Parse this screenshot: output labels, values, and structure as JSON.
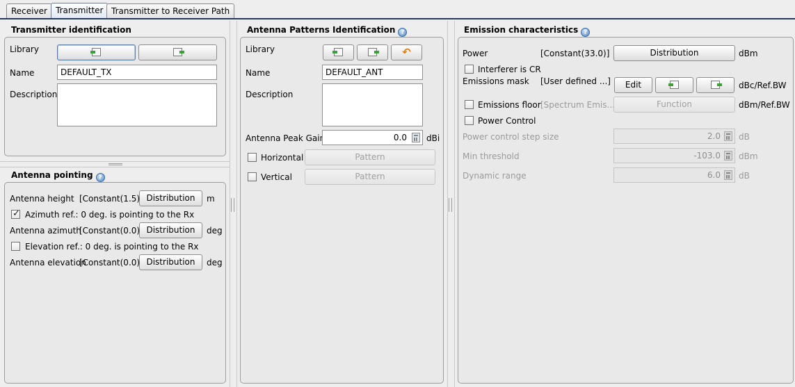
{
  "tabs": [
    {
      "label": "Receiver"
    },
    {
      "label": "Transmitter"
    },
    {
      "label": "Transmitter to Receiver Path"
    }
  ],
  "transmitter_identification": {
    "title": "Transmitter identification",
    "library_label": "Library",
    "import_icon": "import-icon",
    "export_icon": "export-icon",
    "name_label": "Name",
    "name_value": "DEFAULT_TX",
    "description_label": "Description",
    "description_value": ""
  },
  "antenna_pointing": {
    "title": "Antenna pointing",
    "height_label": "Antenna height",
    "height_value": "[Constant(1.5)]",
    "height_button": "Distribution",
    "height_unit": "m",
    "azimuth_ref_label": "Azimuth ref.: 0 deg. is pointing to the Rx",
    "azimuth_ref_checked": true,
    "azimuth_label": "Antenna azimuth",
    "azimuth_value": "[Constant(0.0)]",
    "azimuth_button": "Distribution",
    "azimuth_unit": "deg",
    "elevation_ref_label": "Elevation ref.: 0 deg. is pointing to the Rx",
    "elevation_ref_checked": false,
    "elevation_label": "Antenna elevation",
    "elevation_value": "[Constant(0.0)]",
    "elevation_button": "Distribution",
    "elevation_unit": "deg"
  },
  "antenna_patterns": {
    "title": "Antenna Patterns Identification",
    "library_label": "Library",
    "name_label": "Name",
    "name_value": "DEFAULT_ANT",
    "description_label": "Description",
    "description_value": "",
    "peak_gain_label": "Antenna Peak Gain",
    "peak_gain_value": "0.0",
    "peak_gain_unit": "dBi",
    "horizontal_label": "Horizontal",
    "horizontal_button": "Pattern",
    "vertical_label": "Vertical",
    "vertical_button": "Pattern"
  },
  "emission": {
    "title": "Emission characteristics",
    "power_label": "Power",
    "power_value": "[Constant(33.0)]",
    "power_button": "Distribution",
    "power_unit": "dBm",
    "interferer_label": "Interferer is CR",
    "mask_label": "Emissions mask",
    "mask_value": "[User defined ...]",
    "mask_edit_button": "Edit",
    "mask_unit": "dBc/Ref.BW",
    "floor_label": "Emissions floor",
    "floor_value": "[Spectrum Emis...]",
    "floor_button": "Function",
    "floor_unit": "dBm/Ref.BW",
    "power_control_label": "Power Control",
    "step_label": "Power control step size",
    "step_value": "2.0",
    "step_unit": "dB",
    "min_threshold_label": "Min threshold",
    "min_threshold_value": "-103.0",
    "min_threshold_unit": "dBm",
    "dynamic_range_label": "Dynamic range",
    "dynamic_range_value": "6.0",
    "dynamic_range_unit": "dB"
  }
}
